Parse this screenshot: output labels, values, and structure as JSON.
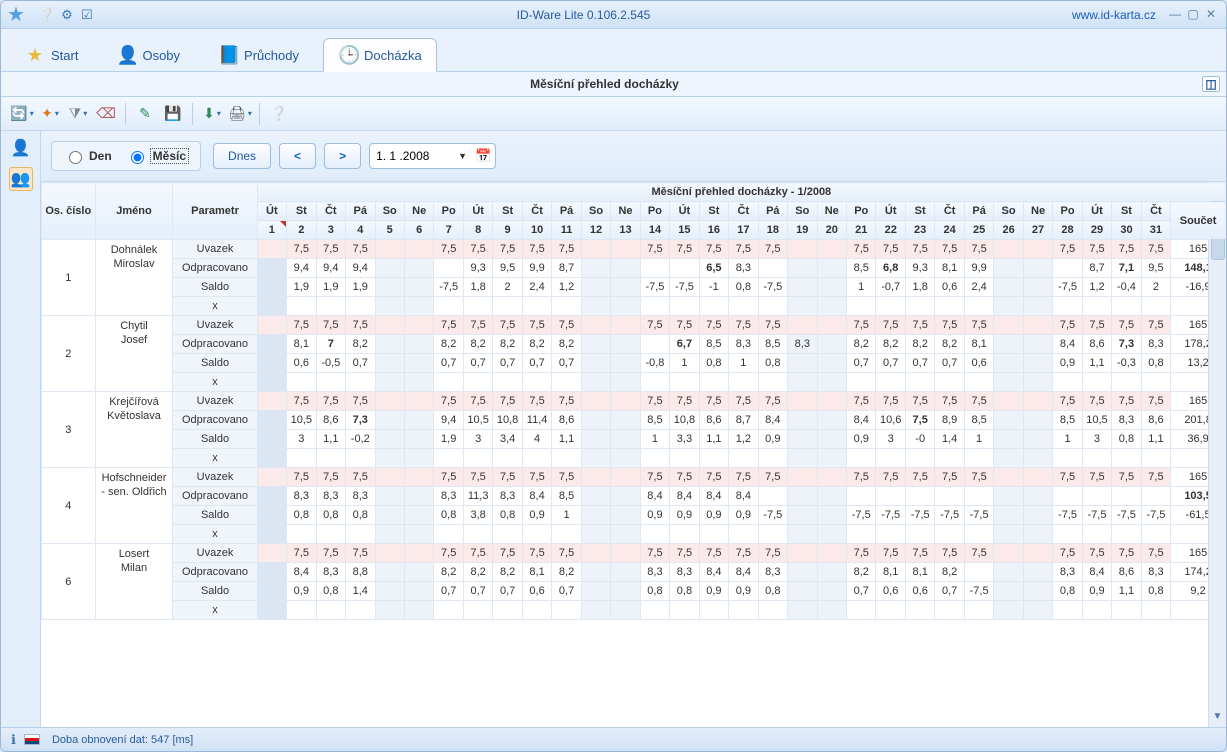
{
  "titlebar": {
    "app_title": "ID-Ware Lite 0.106.2.545",
    "link_text": "www.id-karta.cz"
  },
  "tabs": {
    "start": "Start",
    "osoby": "Osoby",
    "pruchody": "Průchody",
    "dochazka": "Docházka"
  },
  "subheader": {
    "title": "Měsíční přehled docházky"
  },
  "controls": {
    "den": "Den",
    "mesic": "Měsíc",
    "dnes": "Dnes",
    "date": "1. 1 .2008"
  },
  "grid": {
    "header_os": "Os. číslo",
    "header_name": "Jméno",
    "header_param": "Parametr",
    "header_overview": "Měsíční přehled docházky - 1/2008",
    "header_sum": "Součet",
    "day_labels": [
      "Út",
      "St",
      "Čt",
      "Pá",
      "So",
      "Ne",
      "Po",
      "Út",
      "St",
      "Čt",
      "Pá",
      "So",
      "Ne",
      "Po",
      "Út",
      "St",
      "Čt",
      "Pá",
      "So",
      "Ne",
      "Po",
      "Út",
      "St",
      "Čt",
      "Pá",
      "So",
      "Ne",
      "Po",
      "Út",
      "St",
      "Čt"
    ],
    "day_nums": [
      "1",
      "2",
      "3",
      "4",
      "5",
      "6",
      "7",
      "8",
      "9",
      "10",
      "11",
      "12",
      "13",
      "14",
      "15",
      "16",
      "17",
      "18",
      "19",
      "20",
      "21",
      "22",
      "23",
      "24",
      "25",
      "26",
      "27",
      "28",
      "29",
      "30",
      "31"
    ],
    "weekend_idx": [
      4,
      5,
      11,
      12,
      18,
      19,
      25,
      26
    ],
    "holiday_idx": [
      0
    ],
    "params": {
      "uvazek": "Uvazek",
      "odprac": "Odpracovano",
      "saldo": "Saldo",
      "x": "x"
    },
    "rows": [
      {
        "os": "1",
        "name": "Dohnálek Miroslav",
        "lines": [
          {
            "p": "uvazek",
            "sum": "165",
            "v": [
              "",
              "7,5",
              "7,5",
              "7,5",
              "",
              "",
              "7,5",
              "7,5",
              "7,5",
              "7,5",
              "7,5",
              "",
              "",
              "7,5",
              "7,5",
              "7,5",
              "7,5",
              "7,5",
              "",
              "",
              "7,5",
              "7,5",
              "7,5",
              "7,5",
              "7,5",
              "",
              "",
              "7,5",
              "7,5",
              "7,5",
              "7,5"
            ]
          },
          {
            "p": "odprac",
            "sum": "148,1",
            "sumB": true,
            "v": [
              "",
              "9,4",
              "9,4",
              "9,4",
              "",
              "",
              "",
              "9,3",
              "9,5",
              "9,9",
              "8,7",
              "",
              "",
              "",
              "",
              "6,5",
              "8,3",
              "",
              "",
              "",
              "8,5",
              "6,8",
              "9,3",
              "8,1",
              "9,9",
              "",
              "",
              "",
              "8,7",
              "7,1",
              "9,5"
            ],
            "bold_idx": [
              15,
              21,
              29
            ]
          },
          {
            "p": "saldo",
            "sum": "-16,9",
            "v": [
              "",
              "1,9",
              "1,9",
              "1,9",
              "",
              "",
              "-7,5",
              "1,8",
              "2",
              "2,4",
              "1,2",
              "",
              "",
              "-7,5",
              "-7,5",
              "-1",
              "0,8",
              "-7,5",
              "",
              "",
              "1",
              "-0,7",
              "1,8",
              "0,6",
              "2,4",
              "",
              "",
              "-7,5",
              "1,2",
              "-0,4",
              "2"
            ]
          },
          {
            "p": "x",
            "sum": "",
            "v": [
              "",
              "",
              "",
              "",
              "",
              "",
              "",
              "",
              "",
              "",
              "",
              "",
              "",
              "",
              "",
              "",
              "",
              "",
              "",
              "",
              "",
              "",
              "",
              "",
              "",
              "",
              "",
              "",
              "",
              "",
              ""
            ]
          }
        ]
      },
      {
        "os": "2",
        "name": "Chytil Josef",
        "lines": [
          {
            "p": "uvazek",
            "sum": "165",
            "v": [
              "",
              "7,5",
              "7,5",
              "7,5",
              "",
              "",
              "7,5",
              "7,5",
              "7,5",
              "7,5",
              "7,5",
              "",
              "",
              "7,5",
              "7,5",
              "7,5",
              "7,5",
              "7,5",
              "",
              "",
              "7,5",
              "7,5",
              "7,5",
              "7,5",
              "7,5",
              "",
              "",
              "7,5",
              "7,5",
              "7,5",
              "7,5"
            ]
          },
          {
            "p": "odprac",
            "sum": "178,2",
            "v": [
              "",
              "8,1",
              "7",
              "8,2",
              "",
              "",
              "8,2",
              "8,2",
              "8,2",
              "8,2",
              "8,2",
              "",
              "",
              "",
              "6,7",
              "8,5",
              "8,3",
              "8,5",
              "8,3",
              "",
              "8,2",
              "8,2",
              "8,2",
              "8,2",
              "8,1",
              "",
              "",
              "8,4",
              "8,6",
              "7,3",
              "8,3"
            ],
            "bold_idx": [
              2,
              14,
              29
            ]
          },
          {
            "p": "saldo",
            "sum": "13,2",
            "v": [
              "",
              "0,6",
              "-0,5",
              "0,7",
              "",
              "",
              "0,7",
              "0,7",
              "0,7",
              "0,7",
              "0,7",
              "",
              "",
              "-0,8",
              "1",
              "0,8",
              "1",
              "0,8",
              "",
              "",
              "0,7",
              "0,7",
              "0,7",
              "0,7",
              "0,6",
              "",
              "",
              "0,9",
              "1,1",
              "-0,3",
              "0,8"
            ]
          },
          {
            "p": "x",
            "sum": "",
            "v": [
              "",
              "",
              "",
              "",
              "",
              "",
              "",
              "",
              "",
              "",
              "",
              "",
              "",
              "",
              "",
              "",
              "",
              "",
              "",
              "",
              "",
              "",
              "",
              "",
              "",
              "",
              "",
              "",
              "",
              "",
              ""
            ]
          }
        ]
      },
      {
        "os": "3",
        "name": "Krejčířová Květoslava",
        "lines": [
          {
            "p": "uvazek",
            "sum": "165",
            "v": [
              "",
              "7,5",
              "7,5",
              "7,5",
              "",
              "",
              "7,5",
              "7,5",
              "7,5",
              "7,5",
              "7,5",
              "",
              "",
              "7,5",
              "7,5",
              "7,5",
              "7,5",
              "7,5",
              "",
              "",
              "7,5",
              "7,5",
              "7,5",
              "7,5",
              "7,5",
              "",
              "",
              "7,5",
              "7,5",
              "7,5",
              "7,5"
            ]
          },
          {
            "p": "odprac",
            "sum": "201,8",
            "v": [
              "",
              "10,5",
              "8,6",
              "7,3",
              "",
              "",
              "9,4",
              "10,5",
              "10,8",
              "11,4",
              "8,6",
              "",
              "",
              "8,5",
              "10,8",
              "8,6",
              "8,7",
              "8,4",
              "",
              "",
              "8,4",
              "10,6",
              "7,5",
              "8,9",
              "8,5",
              "",
              "",
              "8,5",
              "10,5",
              "8,3",
              "8,6"
            ],
            "bold_idx": [
              3,
              22
            ]
          },
          {
            "p": "saldo",
            "sum": "36,9",
            "v": [
              "",
              "3",
              "1,1",
              "-0,2",
              "",
              "",
              "1,9",
              "3",
              "3,4",
              "4",
              "1,1",
              "",
              "",
              "1",
              "3,3",
              "1,1",
              "1,2",
              "0,9",
              "",
              "",
              "0,9",
              "3",
              "-0",
              "1,4",
              "1",
              "",
              "",
              "1",
              "3",
              "0,8",
              "1,1"
            ]
          },
          {
            "p": "x",
            "sum": "",
            "v": [
              "",
              "",
              "",
              "",
              "",
              "",
              "",
              "",
              "",
              "",
              "",
              "",
              "",
              "",
              "",
              "",
              "",
              "",
              "",
              "",
              "",
              "",
              "",
              "",
              "",
              "",
              "",
              "",
              "",
              "",
              ""
            ]
          }
        ]
      },
      {
        "os": "4",
        "name": "Hofschneider - sen. Oldřich",
        "lines": [
          {
            "p": "uvazek",
            "sum": "165",
            "v": [
              "",
              "7,5",
              "7,5",
              "7,5",
              "",
              "",
              "7,5",
              "7,5",
              "7,5",
              "7,5",
              "7,5",
              "",
              "",
              "7,5",
              "7,5",
              "7,5",
              "7,5",
              "7,5",
              "",
              "",
              "7,5",
              "7,5",
              "7,5",
              "7,5",
              "7,5",
              "",
              "",
              "7,5",
              "7,5",
              "7,5",
              "7,5"
            ]
          },
          {
            "p": "odprac",
            "sum": "103,5",
            "sumB": true,
            "v": [
              "",
              "8,3",
              "8,3",
              "8,3",
              "",
              "",
              "8,3",
              "11,3",
              "8,3",
              "8,4",
              "8,5",
              "",
              "",
              "8,4",
              "8,4",
              "8,4",
              "8,4",
              "",
              "",
              "",
              "",
              "",
              "",
              "",
              "",
              "",
              "",
              "",
              "",
              "",
              ""
            ]
          },
          {
            "p": "saldo",
            "sum": "-61,5",
            "v": [
              "",
              "0,8",
              "0,8",
              "0,8",
              "",
              "",
              "0,8",
              "3,8",
              "0,8",
              "0,9",
              "1",
              "",
              "",
              "0,9",
              "0,9",
              "0,9",
              "0,9",
              "-7,5",
              "",
              "",
              "-7,5",
              "-7,5",
              "-7,5",
              "-7,5",
              "-7,5",
              "",
              "",
              "-7,5",
              "-7,5",
              "-7,5",
              "-7,5"
            ]
          },
          {
            "p": "x",
            "sum": "",
            "v": [
              "",
              "",
              "",
              "",
              "",
              "",
              "",
              "",
              "",
              "",
              "",
              "",
              "",
              "",
              "",
              "",
              "",
              "",
              "",
              "",
              "",
              "",
              "",
              "",
              "",
              "",
              "",
              "",
              "",
              "",
              ""
            ]
          }
        ]
      },
      {
        "os": "6",
        "name": "Losert Milan",
        "lines": [
          {
            "p": "uvazek",
            "sum": "165",
            "v": [
              "",
              "7,5",
              "7,5",
              "7,5",
              "",
              "",
              "7,5",
              "7,5",
              "7,5",
              "7,5",
              "7,5",
              "",
              "",
              "7,5",
              "7,5",
              "7,5",
              "7,5",
              "7,5",
              "",
              "",
              "7,5",
              "7,5",
              "7,5",
              "7,5",
              "7,5",
              "",
              "",
              "7,5",
              "7,5",
              "7,5",
              "7,5"
            ]
          },
          {
            "p": "odprac",
            "sum": "174,2",
            "v": [
              "",
              "8,4",
              "8,3",
              "8,8",
              "",
              "",
              "8,2",
              "8,2",
              "8,2",
              "8,1",
              "8,2",
              "",
              "",
              "8,3",
              "8,3",
              "8,4",
              "8,4",
              "8,3",
              "",
              "",
              "8,2",
              "8,1",
              "8,1",
              "8,2",
              "",
              "",
              "",
              "8,3",
              "8,4",
              "8,6",
              "8,3"
            ]
          },
          {
            "p": "saldo",
            "sum": "9,2",
            "v": [
              "",
              "0,9",
              "0,8",
              "1,4",
              "",
              "",
              "0,7",
              "0,7",
              "0,7",
              "0,6",
              "0,7",
              "",
              "",
              "0,8",
              "0,8",
              "0,9",
              "0,9",
              "0,8",
              "",
              "",
              "0,7",
              "0,6",
              "0,6",
              "0,7",
              "-7,5",
              "",
              "",
              "0,8",
              "0,9",
              "1,1",
              "0,8"
            ]
          },
          {
            "p": "x",
            "sum": "",
            "v": [
              "",
              "",
              "",
              "",
              "",
              "",
              "",
              "",
              "",
              "",
              "",
              "",
              "",
              "",
              "",
              "",
              "",
              "",
              "",
              "",
              "",
              "",
              "",
              "",
              "",
              "",
              "",
              "",
              "",
              "",
              ""
            ]
          }
        ]
      }
    ]
  },
  "statusbar": {
    "text": "Doba obnovení dat: 547 [ms]"
  }
}
